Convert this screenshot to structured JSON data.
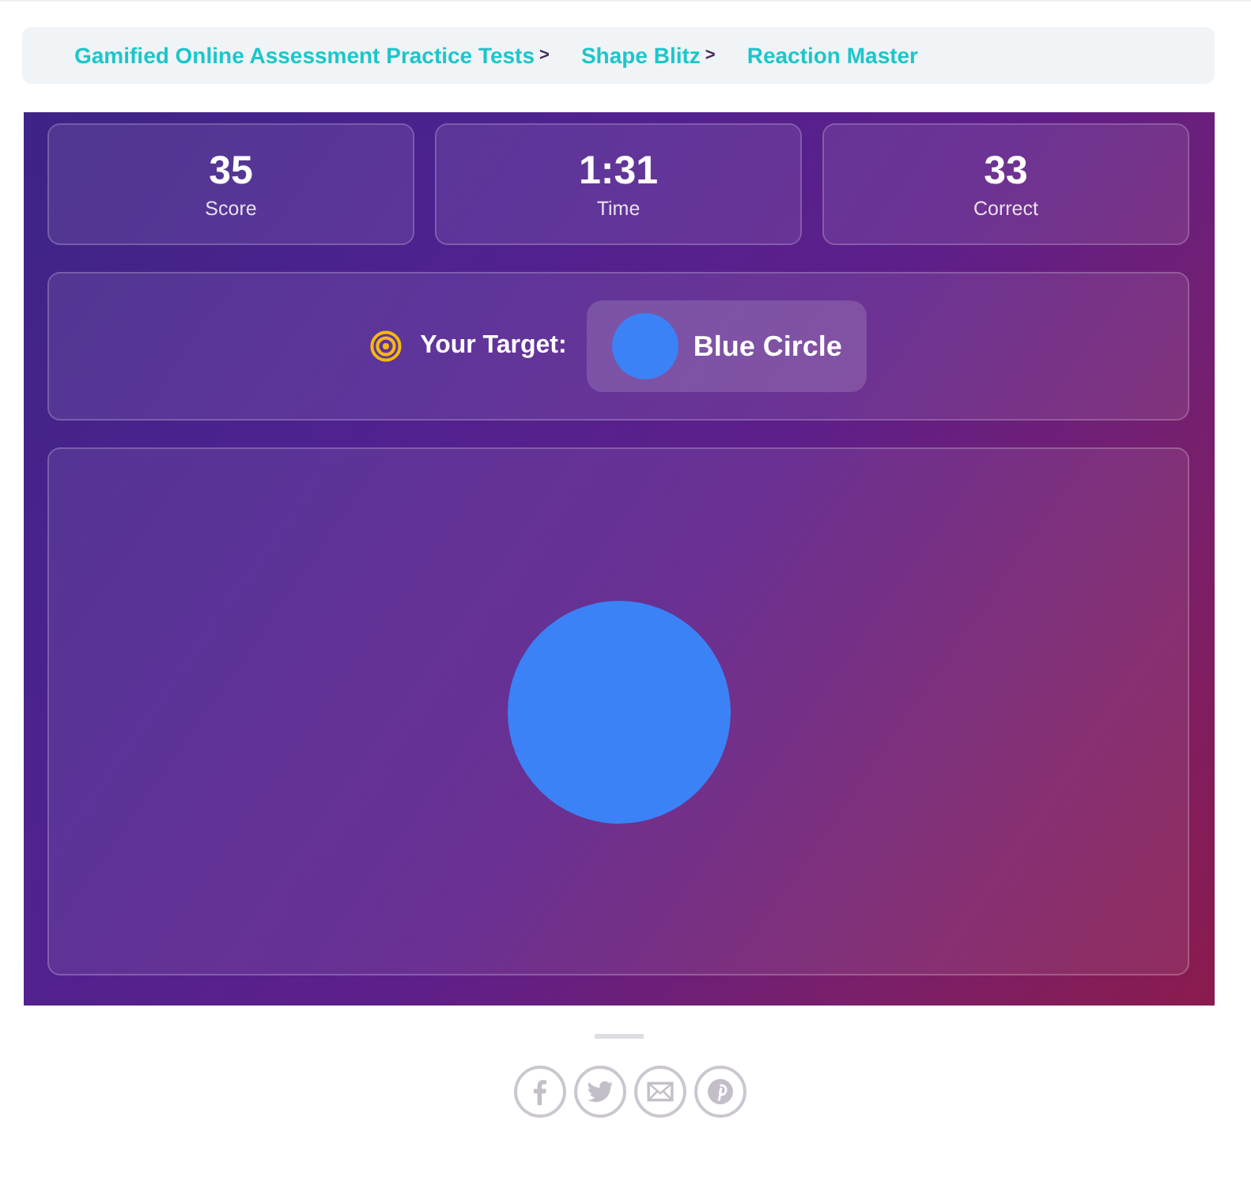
{
  "breadcrumb": [
    {
      "label": "Gamified Online Assessment Practice Tests",
      "separator": ">"
    },
    {
      "label": "Shape Blitz",
      "separator": ">"
    },
    {
      "label": "Reaction Master"
    }
  ],
  "stats": [
    {
      "value": "35",
      "label": "Score"
    },
    {
      "value": "1:31",
      "label": "Time"
    },
    {
      "value": "33",
      "label": "Correct"
    }
  ],
  "target": {
    "label": "Your Target:",
    "shape_name": "Blue Circle"
  }
}
